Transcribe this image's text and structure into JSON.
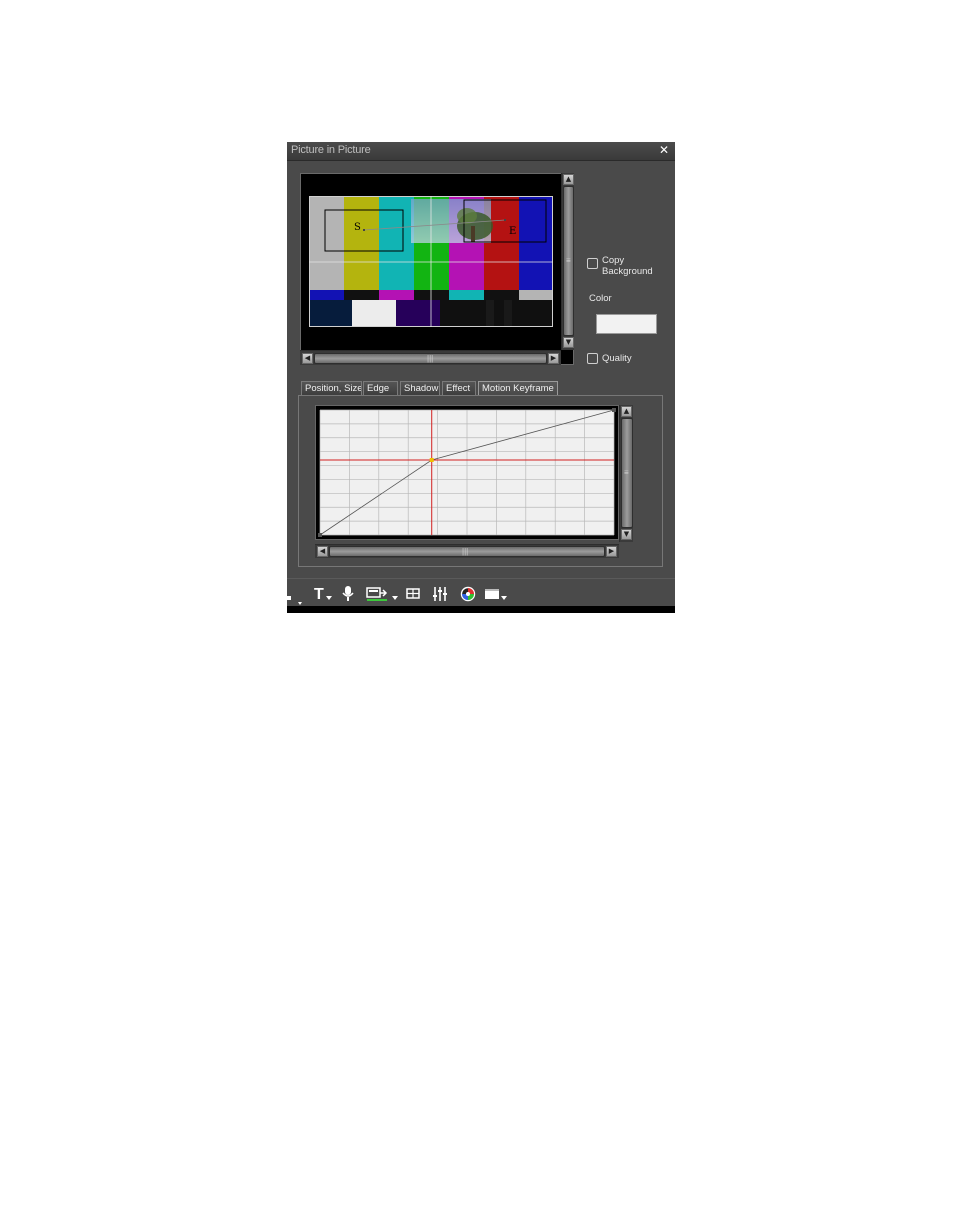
{
  "window": {
    "title": "Picture in Picture",
    "close_glyph": "✕"
  },
  "preview": {
    "start_marker": "S",
    "end_marker": "E"
  },
  "options": {
    "copy_background_label": [
      "Copy",
      "Background"
    ],
    "copy_background_checked": false,
    "color_label": "Color",
    "color_value": "#f2f2f2",
    "quality_label": "Quality",
    "quality_checked": false
  },
  "tabs": [
    {
      "label": "Position, Size",
      "active": false
    },
    {
      "label": "Edge",
      "active": false
    },
    {
      "label": "Shadow",
      "active": false
    },
    {
      "label": "Effect",
      "active": false
    },
    {
      "label": "Motion Keyframe",
      "active": true
    }
  ],
  "toolbar": {
    "items": [
      {
        "icon": "title-text-icon",
        "glyph": "T"
      },
      {
        "icon": "microphone-icon"
      },
      {
        "icon": "export-output-icon"
      },
      {
        "icon": "grid-layout-icon"
      },
      {
        "icon": "mixer-sliders-icon"
      },
      {
        "icon": "color-correction-icon"
      },
      {
        "icon": "window-view-icon"
      }
    ]
  },
  "colors": {
    "panel_bg": "#4a4a4a",
    "graph_bg": "#f0f0f0",
    "crosshair": "#d21f1f",
    "keyframe": "#f0c000"
  },
  "chart_data": {
    "type": "line",
    "title": "",
    "xlabel": "",
    "ylabel": "",
    "xlim": [
      0,
      100
    ],
    "ylim": [
      0,
      100
    ],
    "grid": true,
    "series": [
      {
        "x": [
          0,
          38,
          100
        ],
        "y": [
          0,
          60,
          100
        ]
      }
    ],
    "cursor": {
      "x": 38,
      "y": 60
    }
  }
}
